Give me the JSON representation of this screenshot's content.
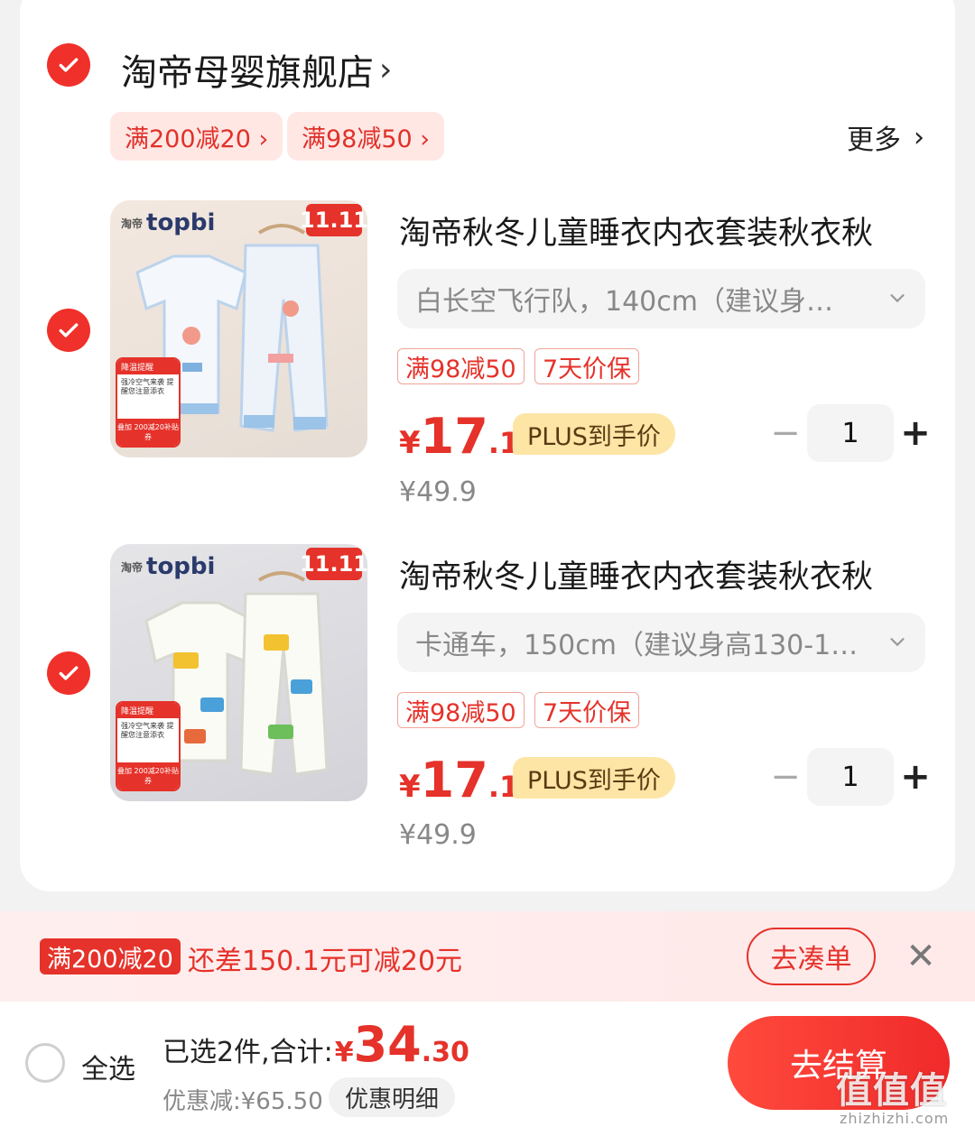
{
  "shop": {
    "name": "淘帝母婴旗舰店",
    "chevron": "›",
    "promos": [
      "满200减20 ›",
      "满98减50 ›"
    ],
    "more_label": "更多",
    "more_chevron": "›"
  },
  "products": [
    {
      "thumb_brand_small": "淘帝",
      "thumb_brand": "topbi",
      "thumb_tag": "11.11",
      "thumb_badge_top": "降温提醒",
      "thumb_badge_mid": "强冷空气来袭 提醒您注意添衣",
      "thumb_badge_bottom": "叠加 200减20补贴券",
      "title": "淘帝秋冬儿童睡衣内衣套装秋衣秋",
      "sku": "白长空飞行队，140cm（建议身…",
      "tags": [
        "满98减50",
        "7天价保"
      ],
      "price_currency": "¥",
      "price_int": "17",
      "price_dec": ".15",
      "plus_label": "PLUS到手价",
      "old_price": "¥49.9",
      "qty": "1",
      "minus": "−",
      "plus": "+"
    },
    {
      "thumb_brand_small": "淘帝",
      "thumb_brand": "topbi",
      "thumb_tag": "11.11",
      "thumb_badge_top": "降温提醒",
      "thumb_badge_mid": "强冷空气来袭 提醒您注意添衣",
      "thumb_badge_bottom": "叠加 200减20补贴券",
      "title": "淘帝秋冬儿童睡衣内衣套装秋衣秋",
      "sku": "卡通车，150cm（建议身高130-1…",
      "tags": [
        "满98减50",
        "7天价保"
      ],
      "price_currency": "¥",
      "price_int": "17",
      "price_dec": ".15",
      "plus_label": "PLUS到手价",
      "old_price": "¥49.9",
      "qty": "1",
      "minus": "−",
      "plus": "+"
    }
  ],
  "promo_bar": {
    "chip": "满200减20",
    "text": "还差150.1元可减20元",
    "button": "去凑单",
    "close": "✕"
  },
  "footer": {
    "select_all": "全选",
    "selected_label": "已选2件,合计:",
    "total_currency": "¥",
    "total_int": "34",
    "total_dec": ".30",
    "discount": "优惠减:¥65.50",
    "detail_button": "优惠明细",
    "checkout_button": "去结算"
  },
  "watermark": {
    "main": "值值值",
    "sub": "zhizhizhi.com"
  },
  "colors": {
    "accent": "#e5322a",
    "check": "#f0302a",
    "plus_badge": "#fde5a5"
  }
}
